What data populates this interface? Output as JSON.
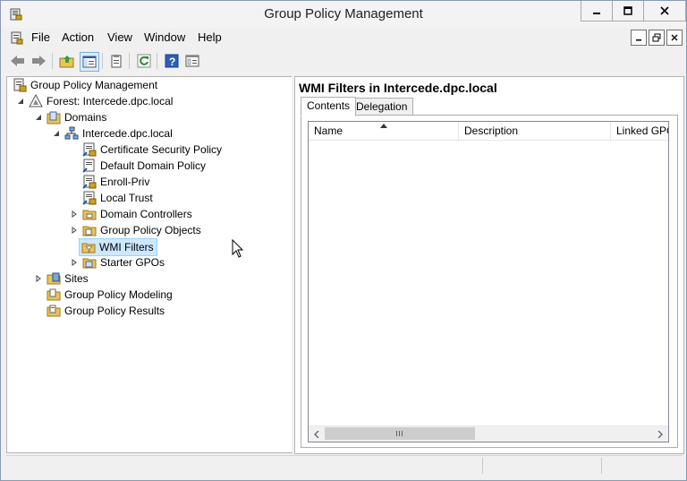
{
  "window": {
    "title": "Group Policy Management"
  },
  "menubar": {
    "items": [
      "File",
      "Action",
      "View",
      "Window",
      "Help"
    ]
  },
  "toolbar": {
    "buttons": [
      "back-icon",
      "forward-icon",
      "up-folder-icon",
      "show-tree-icon",
      "properties-icon",
      "refresh-icon",
      "help-icon",
      "console-icon"
    ]
  },
  "tree": {
    "root": "Group Policy Management",
    "forest": "Forest: Intercede.dpc.local",
    "domains": "Domains",
    "domain": "Intercede.dpc.local",
    "items": [
      "Certificate Security Policy",
      "Default Domain Policy",
      "Enroll-Priv",
      "Local Trust",
      "Domain Controllers",
      "Group Policy Objects",
      "WMI Filters",
      "Starter GPOs"
    ],
    "sites": "Sites",
    "modeling": "Group Policy Modeling",
    "results": "Group Policy Results"
  },
  "right": {
    "title": "WMI Filters in Intercede.dpc.local",
    "tabs": [
      "Contents",
      "Delegation"
    ],
    "columns": [
      "Name",
      "Description",
      "Linked GPO"
    ]
  },
  "colors": {
    "selection": "#cce8ff",
    "accent": "#1e5fa6"
  }
}
